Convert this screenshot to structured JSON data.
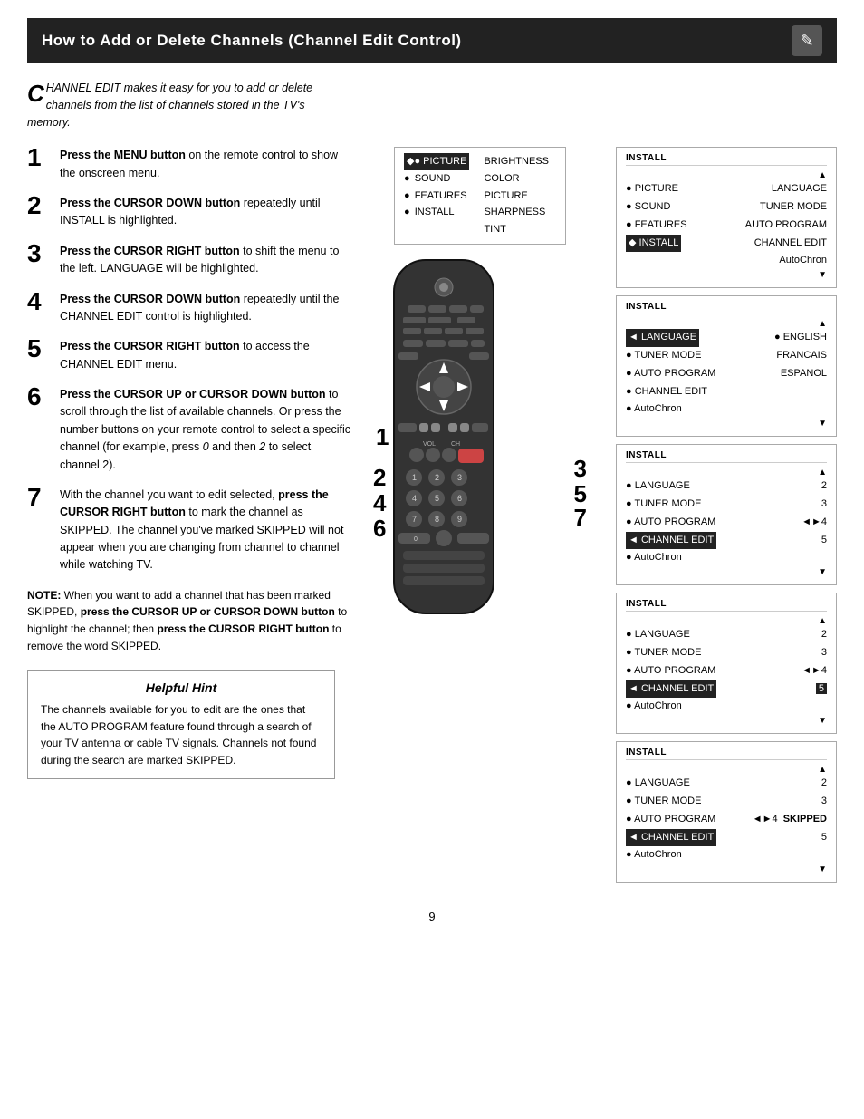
{
  "header": {
    "title": "How to Add or Delete Channels (Channel Edit Control)",
    "icon": "✎"
  },
  "intro": {
    "dropcap": "C",
    "text": "HANNEL EDIT makes it easy for you to add or delete channels from the list of channels stored in the TV's memory."
  },
  "steps": [
    {
      "num": "1",
      "text_bold": "Press the MENU button",
      "text_rest": " on the remote control to show the onscreen menu."
    },
    {
      "num": "2",
      "text_bold": "Press the CURSOR DOWN button",
      "text_rest": " repeatedly until INSTALL is highlighted."
    },
    {
      "num": "3",
      "text_bold": "Press the CURSOR RIGHT button",
      "text_rest": " to shift the menu to the left. LANGUAGE will be highlighted."
    },
    {
      "num": "4",
      "text_bold": "Press the CURSOR DOWN button",
      "text_rest": " repeatedly until the CHANNEL EDIT control is highlighted."
    },
    {
      "num": "5",
      "text_bold": "Press the CURSOR RIGHT button",
      "text_rest": " to access the CHANNEL EDIT menu."
    },
    {
      "num": "6",
      "text_bold": "Press the CURSOR UP or CURSOR DOWN button",
      "text_rest": " to scroll through the list of available channels.  Or press the number buttons on your remote control to select a specific channel (for example, press 0 and then 2 to select channel 2)."
    },
    {
      "num": "7",
      "text_rest1": "With the channel you want to edit selected, ",
      "text_bold": "press the CURSOR RIGHT button",
      "text_rest2": " to mark the channel as SKIPPED.  The channel you've marked SKIPPED will not appear when you are changing from channel to channel while watching TV."
    }
  ],
  "note": {
    "label": "NOTE:",
    "text": "  When you want to add a channel that has been marked SKIPPED, press the CURSOR UP or CURSOR DOWN button to highlight the channel; then press the CURSOR RIGHT button to remove the word SKIPPED."
  },
  "hint": {
    "title": "Helpful Hint",
    "text": "The channels available for you to edit are the ones that the AUTO PROGRAM feature found through a search of your TV antenna or cable TV signals. Channels not found during the search are marked SKIPPED."
  },
  "menu_top": {
    "selected": "◆ PICTURE",
    "items_left": [
      "● SOUND",
      "● FEATURES",
      "● INSTALL"
    ],
    "items_right": [
      "BRIGHTNESS",
      "COLOR",
      "PICTURE",
      "SHARPNESS",
      "TINT"
    ]
  },
  "panels": [
    {
      "title": "INSTALL",
      "up_arrow": "▲",
      "items_left": [
        "● PICTURE",
        "● SOUND",
        "● FEATURES",
        "◆ INSTALL"
      ],
      "items_right": [
        "LANGUAGE",
        "TUNER MODE",
        "AUTO PROGRAM",
        "CHANNEL EDIT",
        "AutoChron"
      ],
      "selected_left": "◆ INSTALL",
      "down_arrow": "▼"
    },
    {
      "title": "INSTALL",
      "up_arrow": "▲",
      "items_left": [
        "◄ LANGUAGE",
        "● TUNER MODE",
        "● AUTO PROGRAM",
        "● CHANNEL EDIT",
        "● AutoChron"
      ],
      "items_right": [
        "● ENGLISH",
        "FRANCAIS",
        "ESPANOL"
      ],
      "selected_left": "◄ LANGUAGE",
      "down_arrow": "▼"
    },
    {
      "title": "INSTALL",
      "up_arrow": "▲",
      "items_left": [
        "● LANGUAGE",
        "● TUNER MODE",
        "● AUTO PROGRAM",
        "◄ CHANNEL EDIT",
        "● AutoChron"
      ],
      "items_right": [
        "2",
        "3",
        "◄► 4",
        "5"
      ],
      "selected_left": "◄ CHANNEL EDIT",
      "down_arrow": "▼"
    },
    {
      "title": "INSTALL",
      "up_arrow": "▲",
      "items_left": [
        "● LANGUAGE",
        "● TUNER MODE",
        "● AUTO PROGRAM",
        "◄ CHANNEL EDIT",
        "● AutoChron"
      ],
      "items_right": [
        "2",
        "3",
        "◄► 4",
        "5"
      ],
      "selected_left": "◄ CHANNEL EDIT",
      "highlight_right": "5",
      "down_arrow": "▼"
    },
    {
      "title": "INSTALL",
      "up_arrow": "▲",
      "items_left": [
        "● LANGUAGE",
        "● TUNER MODE",
        "● AUTO PROGRAM",
        "◄ CHANNEL EDIT",
        "● AutoChron"
      ],
      "items_right": [
        "2",
        "3",
        "◄► 4  SKIPPED",
        "5"
      ],
      "selected_left": "◄ CHANNEL EDIT",
      "down_arrow": "▼"
    }
  ],
  "page_number": "9"
}
